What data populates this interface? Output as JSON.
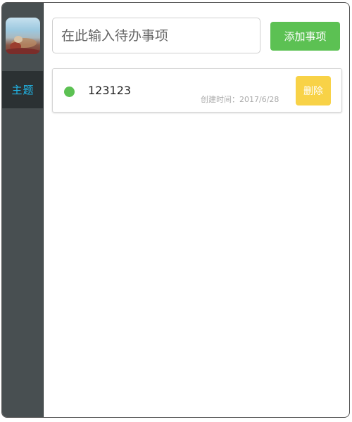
{
  "sidebar": {
    "avatar_icon": "user-avatar-photo",
    "items": [
      {
        "label": "主题",
        "active": true
      }
    ]
  },
  "main": {
    "input": {
      "placeholder": "在此输入待办事项",
      "value": ""
    },
    "add_button_label": "添加事项",
    "todos": [
      {
        "text": "123123",
        "status": "active",
        "created_label": "创建时间：",
        "created_date": "2017/6/28",
        "delete_label": "删除"
      }
    ]
  },
  "colors": {
    "sidebar_bg": "#484f51",
    "sidebar_active_bg": "#2b3133",
    "accent_blue": "#21b5e6",
    "add_green": "#5cc153",
    "delete_yellow": "#f8d247"
  }
}
